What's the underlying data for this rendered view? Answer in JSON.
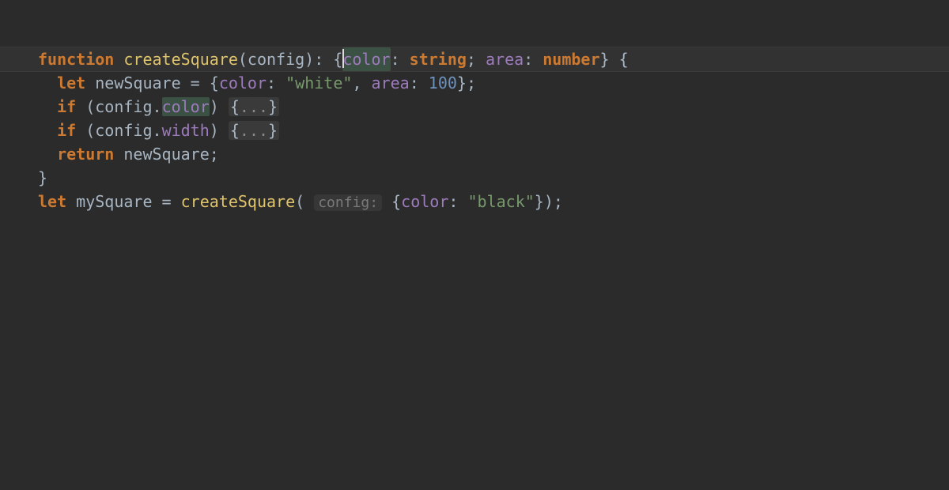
{
  "colors": {
    "background": "#2b2b2b",
    "current_line": "#323232",
    "keyword": "#cc7a32",
    "function": "#e0c46c",
    "identifier": "#a8b6c3",
    "property": "#9d7bbd",
    "string": "#77996b",
    "number": "#6c92bd",
    "selection": "#3b5143",
    "hint_bg": "#373737",
    "hint_fg": "#7a7a7a",
    "fold_bg": "#3a3a3a"
  },
  "ln1": {
    "kw_function": "function",
    "fn_name": "createSquare",
    "open_paren": "(",
    "param": "config",
    "close_paren_colon_sp": "): ",
    "brace_open": "{",
    "type_color_key": "color",
    "colon1": ": ",
    "type_string": "string",
    "semi1": "; ",
    "type_area_key": "area",
    "colon2": ": ",
    "type_number": "number",
    "brace_close": "}",
    "tail": " {"
  },
  "ln2": {
    "indent": "  ",
    "kw_let": "let",
    "sp1": " ",
    "var_name": "newSquare",
    "eq": " = {",
    "key_color": "color",
    "colon1": ": ",
    "str_white": "\"white\"",
    "comma": ", ",
    "key_area": "area",
    "colon2": ": ",
    "num_100": "100",
    "end": "};"
  },
  "ln3": {
    "indent": "  ",
    "kw_if": "if",
    "open": " (config.",
    "prop_color": "color",
    "close": ") ",
    "fold_open": "{",
    "fold_dots": "...",
    "fold_close": "}"
  },
  "ln4": {
    "indent": "  ",
    "kw_if": "if",
    "open": " (config.",
    "prop_width": "width",
    "close": ") ",
    "fold_open": "{",
    "fold_dots": "...",
    "fold_close": "}"
  },
  "ln5": {
    "indent": "  ",
    "kw_return": "return",
    "sp": " ",
    "var_name": "newSquare",
    "semi": ";"
  },
  "ln6": {
    "brace": "}"
  },
  "ln7": {
    "blank": ""
  },
  "ln8": {
    "kw_let": "let",
    "sp1": " ",
    "var_name": "mySquare",
    "eq": " = ",
    "fn_call": "createSquare",
    "open_paren": "(",
    "hint_sp_pre": " ",
    "hint_label": "config:",
    "hint_sp_post": " ",
    "brace_open": "{",
    "key_color": "color",
    "colon": ": ",
    "str_black": "\"black\"",
    "end": "});"
  }
}
